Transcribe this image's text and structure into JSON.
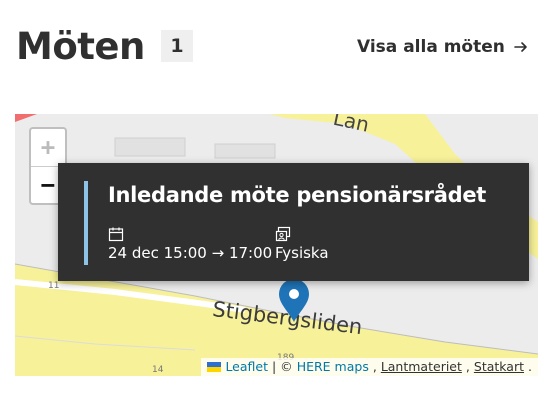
{
  "header": {
    "title": "Möten",
    "count": "1",
    "view_all_label": "Visa alla möten"
  },
  "map": {
    "zoom_in_label": "+",
    "zoom_out_label": "−",
    "street_labels": [
      "Stigbergsliden",
      "Lan"
    ],
    "house_numbers": [
      "11",
      "14",
      "189"
    ],
    "popup": {
      "title": "Inledande möte pensionärsrådet",
      "time": "24 dec 15:00 → 17:00",
      "type": "Fysiska"
    },
    "attribution": {
      "leaflet": "Leaflet",
      "separator": "| ©",
      "here": "HERE maps",
      "comma1": ",",
      "lantmateriet": "Lantmateriet",
      "comma2": ",",
      "statkart": "Statkart",
      "period": "."
    }
  },
  "icons": {
    "arrow": "arrow-right-icon",
    "calendar": "calendar-icon",
    "type": "meeting-type-icon",
    "marker": "map-marker-icon"
  },
  "colors": {
    "popup_bg": "#303030",
    "accent_bar": "#8ec3e8",
    "marker": "#1f74b8",
    "road": "#f7f19a",
    "link": "#0078a8"
  }
}
